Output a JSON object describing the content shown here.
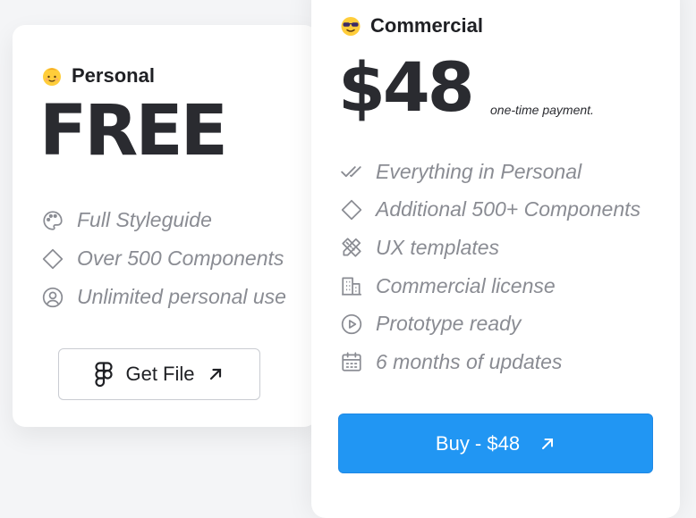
{
  "colors": {
    "accent": "#2196f3",
    "muted_text": "#8a8c93",
    "heading_text": "#1f2024"
  },
  "personal": {
    "emoji_icon": "baby-face-icon",
    "name": "Personal",
    "price": "FREE",
    "features": [
      {
        "icon": "palette-icon",
        "label": "Full Styleguide"
      },
      {
        "icon": "diamond-icon",
        "label": "Over 500 Components"
      },
      {
        "icon": "user-circle-icon",
        "label": "Unlimited personal use"
      }
    ],
    "button": {
      "icon": "figma-icon",
      "label": "Get File",
      "trailing_icon": "arrow-up-right-icon"
    }
  },
  "commercial": {
    "emoji_icon": "sunglasses-face-icon",
    "name": "Commercial",
    "price": "$48",
    "price_note": "one-time payment.",
    "features": [
      {
        "icon": "double-check-icon",
        "label": "Everything in Personal"
      },
      {
        "icon": "diamond-icon",
        "label": "Additional 500+ Components"
      },
      {
        "icon": "ruler-pencil-icon",
        "label": "UX templates"
      },
      {
        "icon": "building-icon",
        "label": "Commercial license"
      },
      {
        "icon": "play-circle-icon",
        "label": "Prototype ready"
      },
      {
        "icon": "calendar-icon",
        "label": "6 months of updates"
      }
    ],
    "button": {
      "label": "Buy - $48",
      "trailing_icon": "arrow-up-right-icon"
    }
  }
}
